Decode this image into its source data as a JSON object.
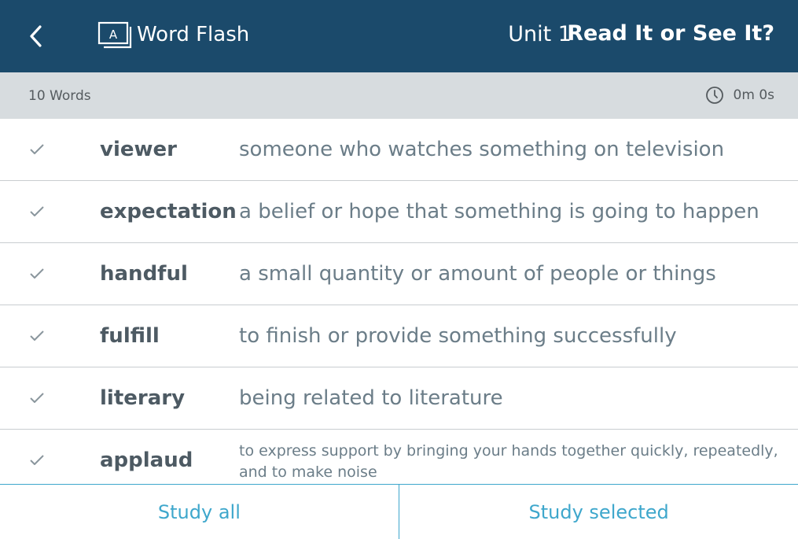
{
  "header": {
    "back_icon": "chevron-left-icon",
    "logo_icon": "word-flash-logo-icon",
    "app_title": "Word Flash",
    "unit": "Unit 1",
    "mode_title": "Read It or See It?",
    "background_color": "#1b4a6b"
  },
  "subheader": {
    "word_count": "10 Words",
    "timer_icon": "clock-icon",
    "timer": "0m 0s"
  },
  "words": [
    {
      "term": "viewer",
      "definition": "someone who watches something on television",
      "check_icon": "check-icon"
    },
    {
      "term": "expectation",
      "definition": "a belief or hope that something is going to happen",
      "check_icon": "check-icon"
    },
    {
      "term": "handful",
      "definition": "a small quantity or amount of people or things",
      "check_icon": "check-icon"
    },
    {
      "term": "fulfill",
      "definition": "to finish or provide something successfully",
      "check_icon": "check-icon"
    },
    {
      "term": "literary",
      "definition": "being related to literature",
      "check_icon": "check-icon"
    },
    {
      "term": "applaud",
      "definition": "to express support by bringing your hands together quickly, repeatedly, and to make noise",
      "check_icon": "check-icon"
    }
  ],
  "footer": {
    "study_all": "Study all",
    "study_selected": "Study selected",
    "accent_color": "#3ea7cc"
  }
}
